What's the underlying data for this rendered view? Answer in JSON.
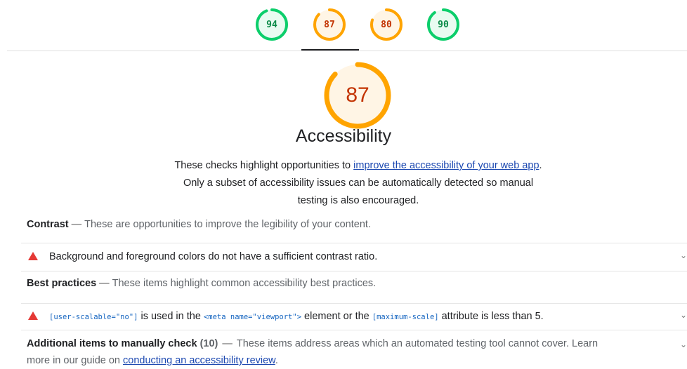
{
  "scores": [
    {
      "value": "94",
      "fraction": 0.94,
      "color": "#0CCE6B",
      "fill": "#e9fbf1",
      "text_color": "#0a8a47",
      "name": "gauge-score-1"
    },
    {
      "value": "87",
      "fraction": 0.87,
      "color": "#FFA400",
      "fill": "#fff5e5",
      "text_color": "#C33300",
      "name": "gauge-score-2"
    },
    {
      "value": "80",
      "fraction": 0.8,
      "color": "#FFA400",
      "fill": "#fff5e5",
      "text_color": "#C33300",
      "name": "gauge-score-3"
    },
    {
      "value": "90",
      "fraction": 0.9,
      "color": "#0CCE6B",
      "fill": "#e9fbf1",
      "text_color": "#0a8a47",
      "name": "gauge-score-4"
    }
  ],
  "category": {
    "score": "87",
    "fraction": 0.87,
    "title": "Accessibility",
    "desc_before": "These checks highlight opportunities to ",
    "desc_link": "improve the accessibility of your web app",
    "desc_after": ". Only a subset of accessibility issues can be automatically detected so manual testing is also encouraged."
  },
  "groups": {
    "contrast": {
      "title": "Contrast",
      "sep": "—",
      "desc": "These are opportunities to improve the legibility of your content."
    },
    "best_practices": {
      "title": "Best practices",
      "sep": "—",
      "desc": "These items highlight common accessibility best practices."
    }
  },
  "audits": {
    "contrast": {
      "text": "Background and foreground colors do not have a sufficient contrast ratio."
    },
    "viewport": {
      "code1": "[user-scalable=\"no\"]",
      "text1": " is used in the ",
      "code2": "<meta name=\"viewport\">",
      "text2": " element or the ",
      "code3": "[maximum-scale]",
      "text3": " attribute is less than 5."
    }
  },
  "manual": {
    "title": "Additional items to manually check",
    "count": "(10)",
    "sep": "—",
    "desc1": "These items address areas which an automated testing tool cannot cover. Learn",
    "desc2": "more in our guide on ",
    "link": "conducting an accessibility review",
    "end": "."
  },
  "icons": {
    "fail": "warning-triangle-icon",
    "expand": "chevron-down-icon"
  },
  "colors": {
    "pass": "#0CCE6B",
    "average": "#FFA400",
    "fail": "#e53935",
    "link": "#1a47b0"
  }
}
